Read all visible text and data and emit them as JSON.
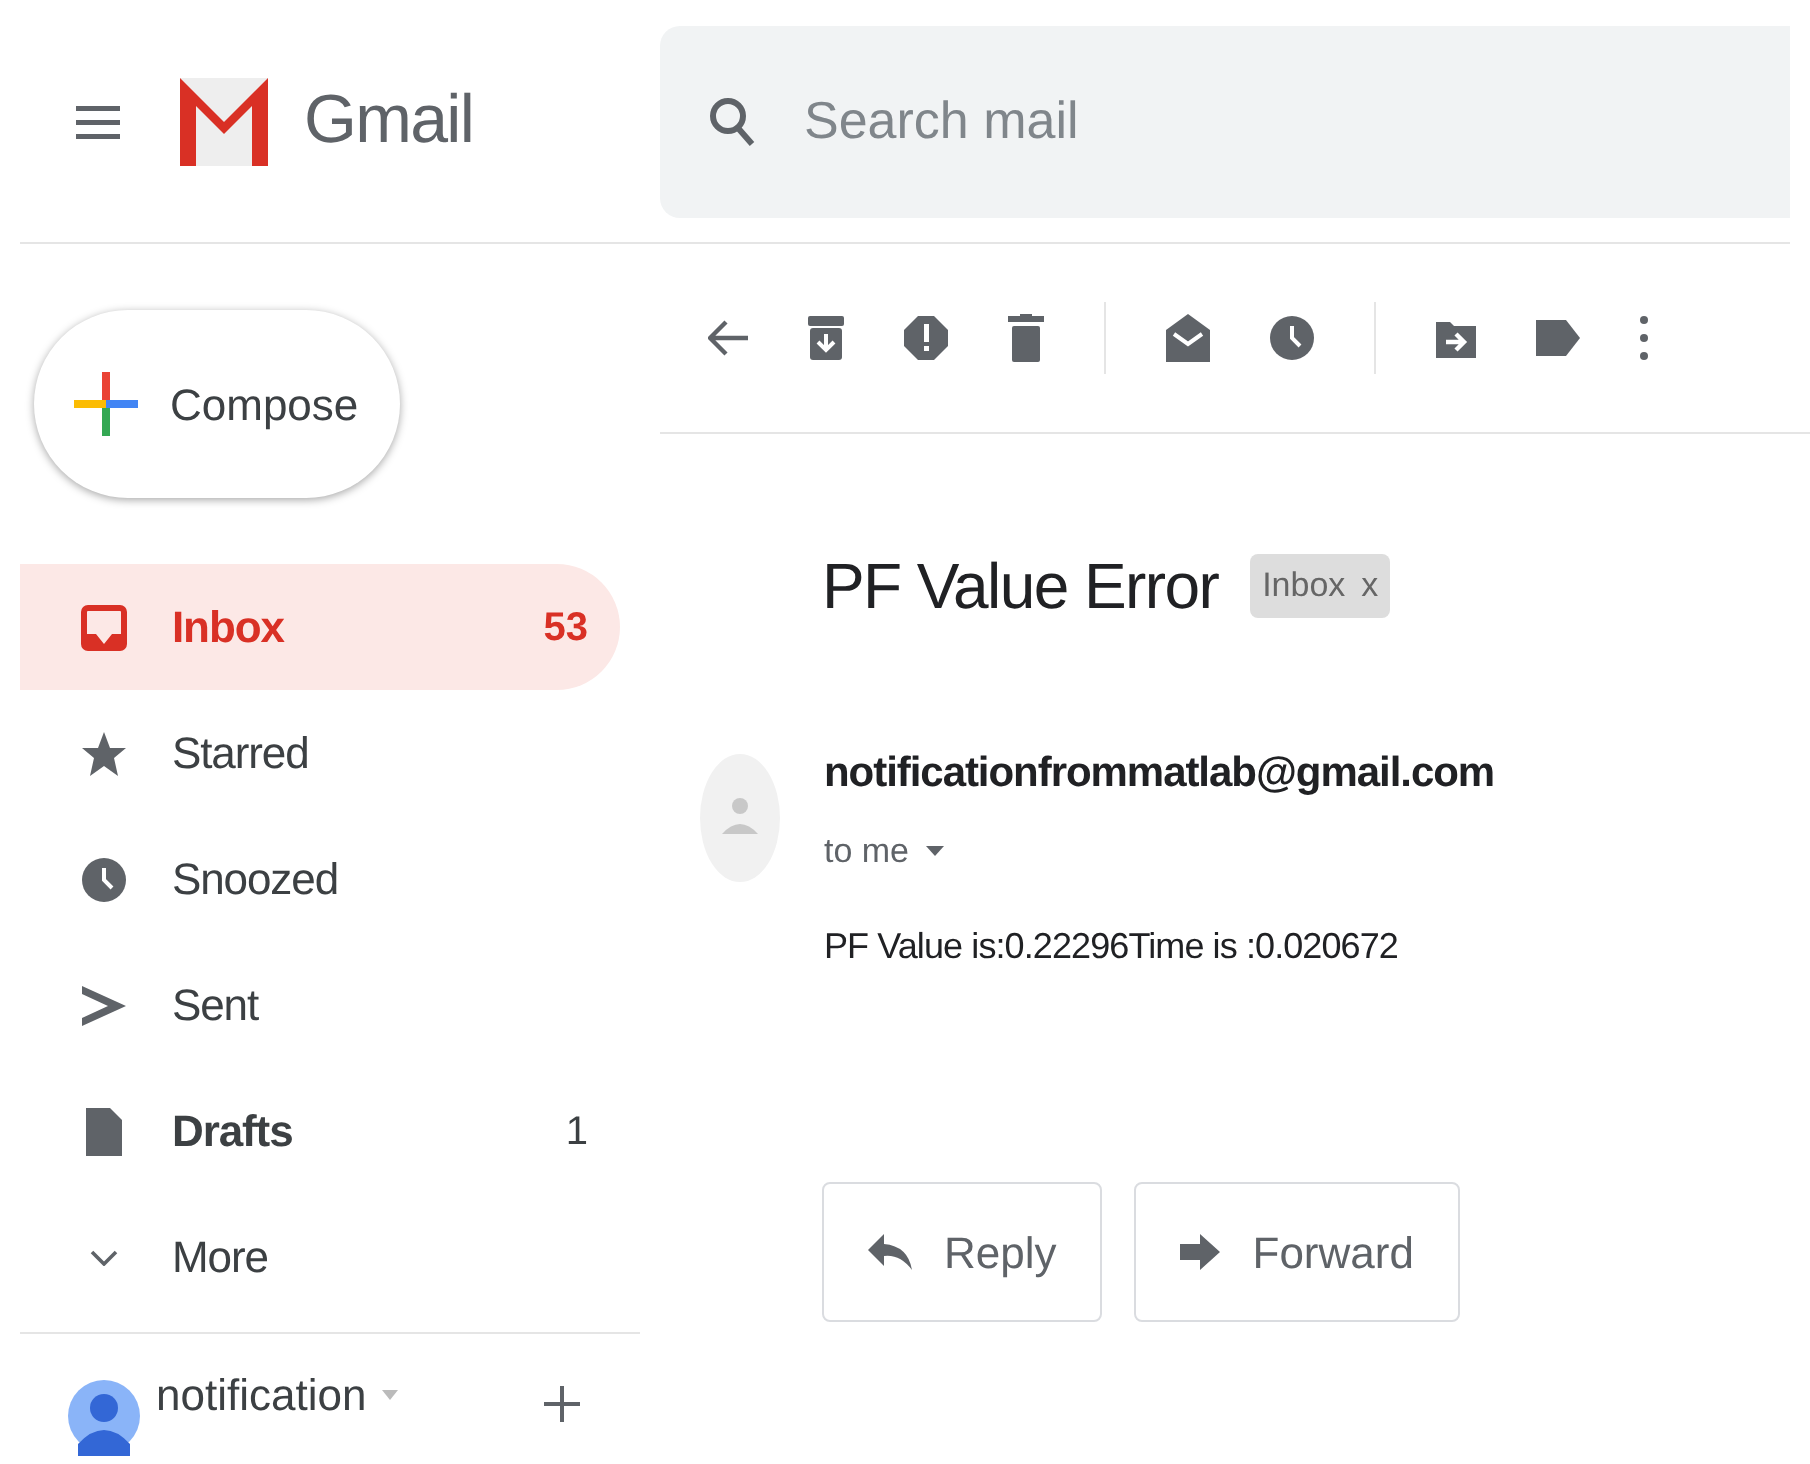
{
  "header": {
    "app_name": "Gmail",
    "search": {
      "placeholder": "Search mail"
    }
  },
  "compose": {
    "label": "Compose"
  },
  "sidebar": {
    "items": [
      {
        "kind": "inbox",
        "label": "Inbox",
        "count": "53",
        "selected": true,
        "bold": true
      },
      {
        "kind": "starred",
        "label": "Starred",
        "selected": false,
        "bold": false
      },
      {
        "kind": "snoozed",
        "label": "Snoozed",
        "selected": false,
        "bold": false
      },
      {
        "kind": "sent",
        "label": "Sent",
        "selected": false,
        "bold": false
      },
      {
        "kind": "drafts",
        "label": "Drafts",
        "count": "1",
        "selected": false,
        "bold": true
      },
      {
        "kind": "more",
        "label": "More",
        "selected": false,
        "bold": false
      }
    ]
  },
  "account": {
    "name": "notification"
  },
  "message": {
    "subject": "PF Value Error",
    "label_chip": "Inbox",
    "chip_close": "x",
    "sender": "notificationfrommatlab@gmail.com",
    "recipient": "to me",
    "body": "PF Value is:0.22296Time is :0.020672"
  },
  "actions": [
    {
      "kind": "reply",
      "label": "Reply"
    },
    {
      "kind": "forward",
      "label": "Forward"
    }
  ]
}
